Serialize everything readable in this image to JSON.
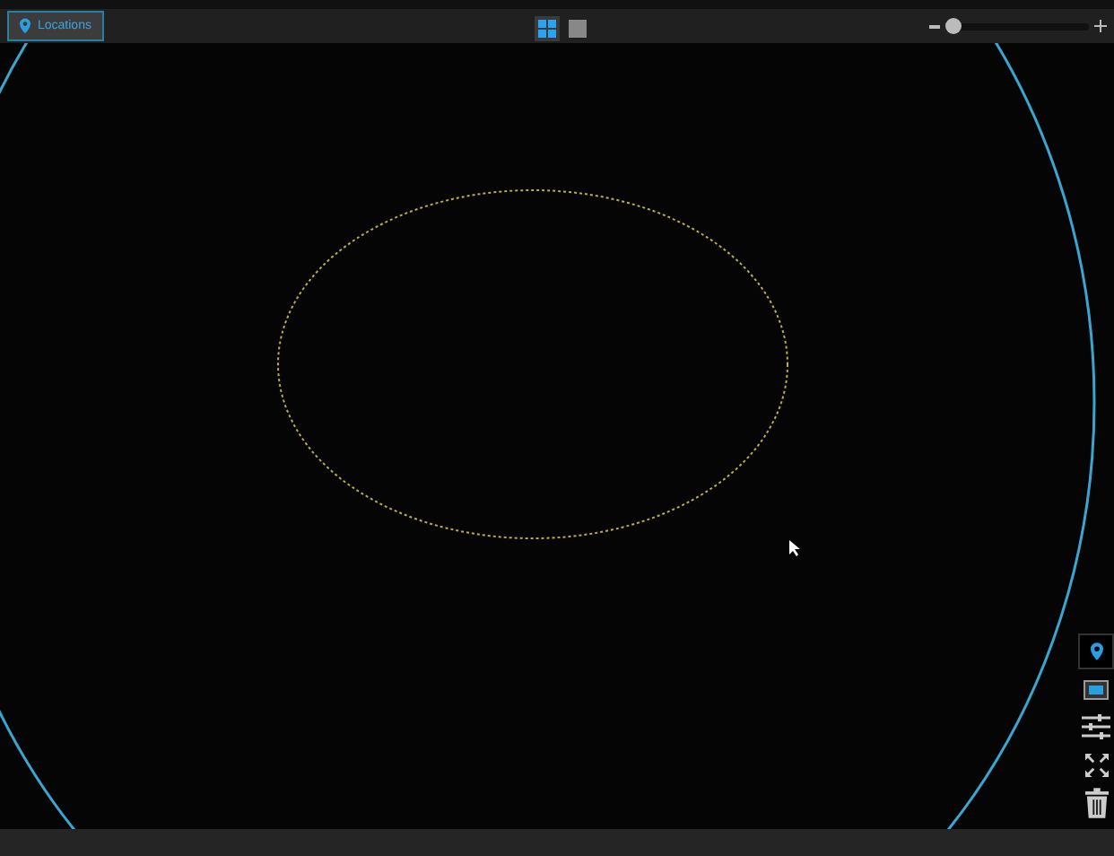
{
  "top_bar": {
    "locations_button": {
      "label": "Locations"
    },
    "view_toggle": [
      {
        "kind": "grid",
        "selected": true
      },
      {
        "kind": "single",
        "selected": false
      }
    ],
    "zoom_slider": {
      "level": 0.05
    }
  },
  "tools": [
    {
      "kind": "pin",
      "selected": true
    },
    {
      "kind": "screen",
      "selected": false
    },
    {
      "kind": "sliders",
      "selected": false
    },
    {
      "kind": "expand",
      "selected": false
    },
    {
      "kind": "trash",
      "selected": false
    }
  ]
}
